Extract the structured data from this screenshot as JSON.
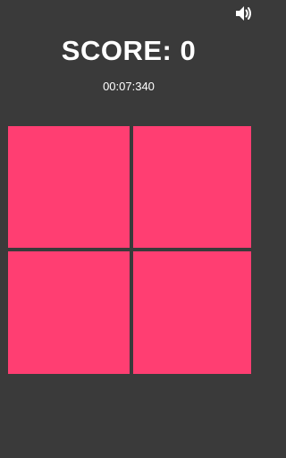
{
  "game": {
    "score_text": "SCORE: 0",
    "timer_text": "00:07:340",
    "sound_icon": "speaker-volume-icon",
    "tile_color": "#ff3e72",
    "background_color": "#3a3a3a",
    "tiles": [
      "",
      "",
      "",
      ""
    ]
  }
}
